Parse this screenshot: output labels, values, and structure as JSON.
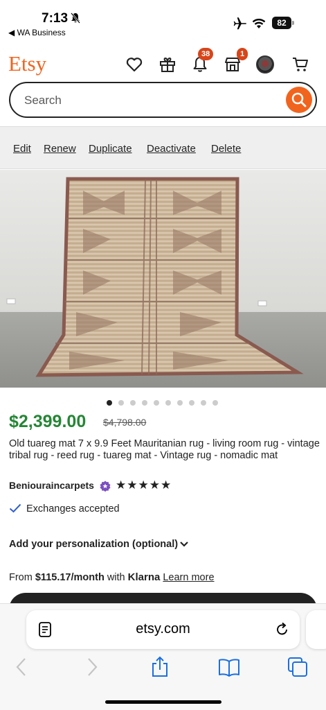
{
  "status_bar": {
    "time": "7:13",
    "back_app": "◀ WA Business",
    "battery": "82"
  },
  "header": {
    "logo": "Etsy",
    "notifications_badge": "38",
    "shop_badge": "1",
    "icons": [
      "heart-icon",
      "gift-icon",
      "bell-icon",
      "shop-icon",
      "avatar",
      "cart-icon"
    ]
  },
  "search": {
    "placeholder": "Search"
  },
  "edit_bar": {
    "items": [
      "Edit",
      "Renew",
      "Duplicate",
      "Deactivate",
      "Delete"
    ]
  },
  "gallery": {
    "image_count": 10,
    "active_index": 0
  },
  "product": {
    "price": "$2,399.00",
    "original_price": "$4,798.00",
    "title": "Old tuareg mat 7 x 9.9 Feet Mauritanian rug - living room rug - vintage tribal rug - reed rug - tuareg mat - Vintage rug - nomadic mat",
    "shop_name": "Beniouraincarpets",
    "rating_stars": "★★★★★",
    "exchanges": "Exchanges accepted",
    "personalization": "Add your personalization (optional)",
    "klarna_from": "From ",
    "klarna_amount": "$115.17/month",
    "klarna_with": " with ",
    "klarna_brand": "Klarna",
    "klarna_link": "Learn more"
  },
  "browser": {
    "url": "etsy.com"
  },
  "colors": {
    "brand": "#f1641e",
    "price": "#258635",
    "badge": "#d8451a"
  }
}
